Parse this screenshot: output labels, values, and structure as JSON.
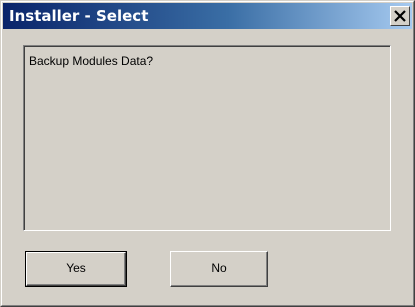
{
  "window": {
    "title": "Installer - Select",
    "close_icon": "close-icon"
  },
  "dialog": {
    "message": "Backup Modules Data?"
  },
  "buttons": {
    "yes_label": "Yes",
    "no_label": "No"
  },
  "colors": {
    "face": "#d4d0c8",
    "titlebar_start": "#0a246a",
    "titlebar_end": "#a6caf0",
    "title_text": "#ffffff"
  }
}
